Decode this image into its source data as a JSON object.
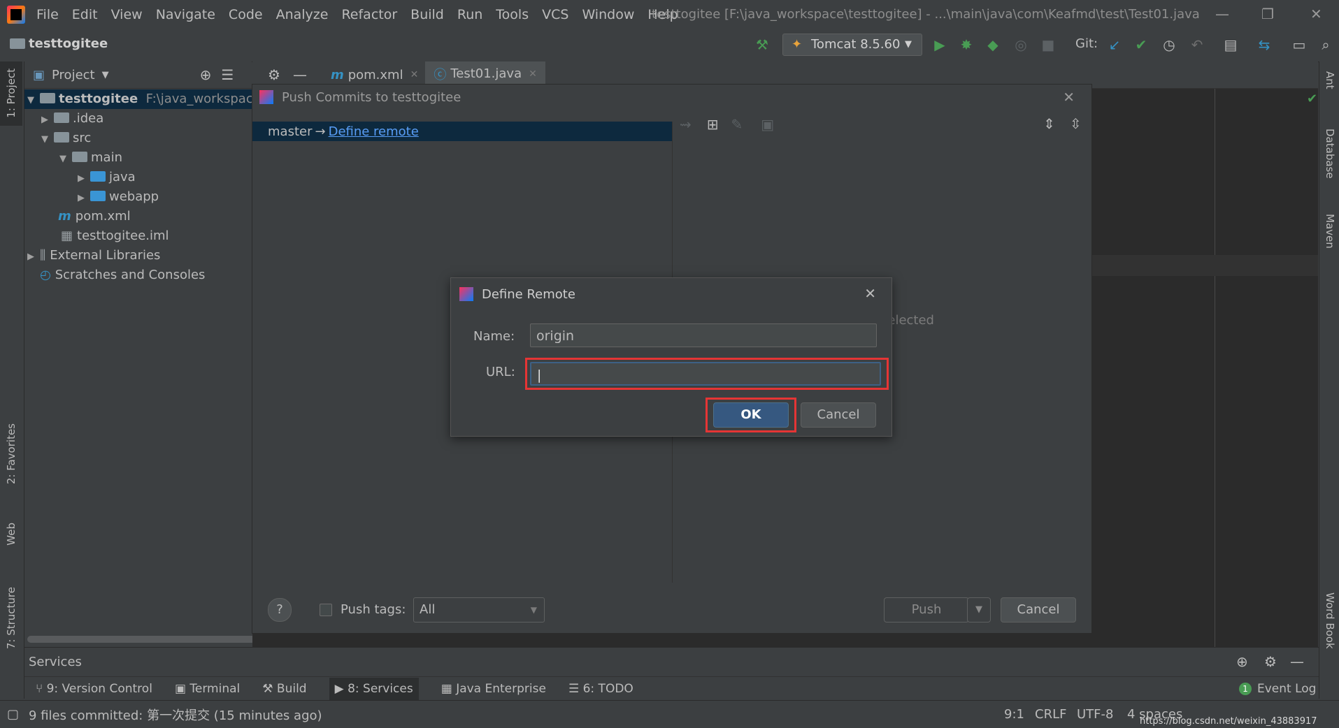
{
  "menubar": {
    "items": [
      "File",
      "Edit",
      "View",
      "Navigate",
      "Code",
      "Analyze",
      "Refactor",
      "Build",
      "Run",
      "Tools",
      "VCS",
      "Window",
      "Help"
    ],
    "window_title": "testtogitee [F:\\java_workspace\\testtogitee] - ...\\main\\java\\com\\Keafmd\\test\\Test01.java"
  },
  "navbar": {
    "project_name": "testtogitee",
    "run_config": "Tomcat 8.5.60",
    "git_label": "Git:"
  },
  "project_panel": {
    "title": "Project",
    "root": {
      "name": "testtogitee",
      "path": "F:\\java_workspace\\t"
    },
    "nodes": [
      ".idea",
      "src",
      "main",
      "java",
      "webapp",
      "pom.xml",
      "testtogitee.iml",
      "External Libraries",
      "Scratches and Consoles"
    ]
  },
  "editor_tabs": [
    "pom.xml",
    "Test01.java"
  ],
  "left_stripe": [
    "1: Project",
    "2: Favorites",
    "Web",
    "7: Structure"
  ],
  "right_stripe": [
    "Ant",
    "Database",
    "Maven",
    "Word Book"
  ],
  "push_dialog": {
    "title": "Push Commits to testtogitee",
    "branch": "master",
    "arrow": "→",
    "define_remote_link": "Define remote",
    "right_hint": "selected",
    "help": "?",
    "push_tags_label": "Push tags:",
    "push_tags_value": "All",
    "push_button": "Push",
    "cancel_button": "Cancel"
  },
  "define_remote": {
    "title": "Define Remote",
    "name_label": "Name:",
    "name_value": "origin",
    "url_label": "URL:",
    "url_value": "",
    "ok_button": "OK",
    "cancel_button": "Cancel"
  },
  "services": {
    "title": "Services"
  },
  "bottom_tabs": [
    "9: Version Control",
    "Terminal",
    "Build",
    "8: Services",
    "Java Enterprise",
    "6: TODO"
  ],
  "event_log": {
    "count": "1",
    "label": "Event Log"
  },
  "statusbar": {
    "message": "9 files committed: 第一次提交 (15 minutes ago)",
    "position": "9:1",
    "line_sep": "CRLF",
    "encoding": "UTF-8",
    "indent": "4 spaces",
    "watermark": "https://blog.csdn.net/weixin_43883917"
  },
  "colors": {
    "accent": "#365880",
    "highlight": "#e53535",
    "link": "#589df6"
  }
}
